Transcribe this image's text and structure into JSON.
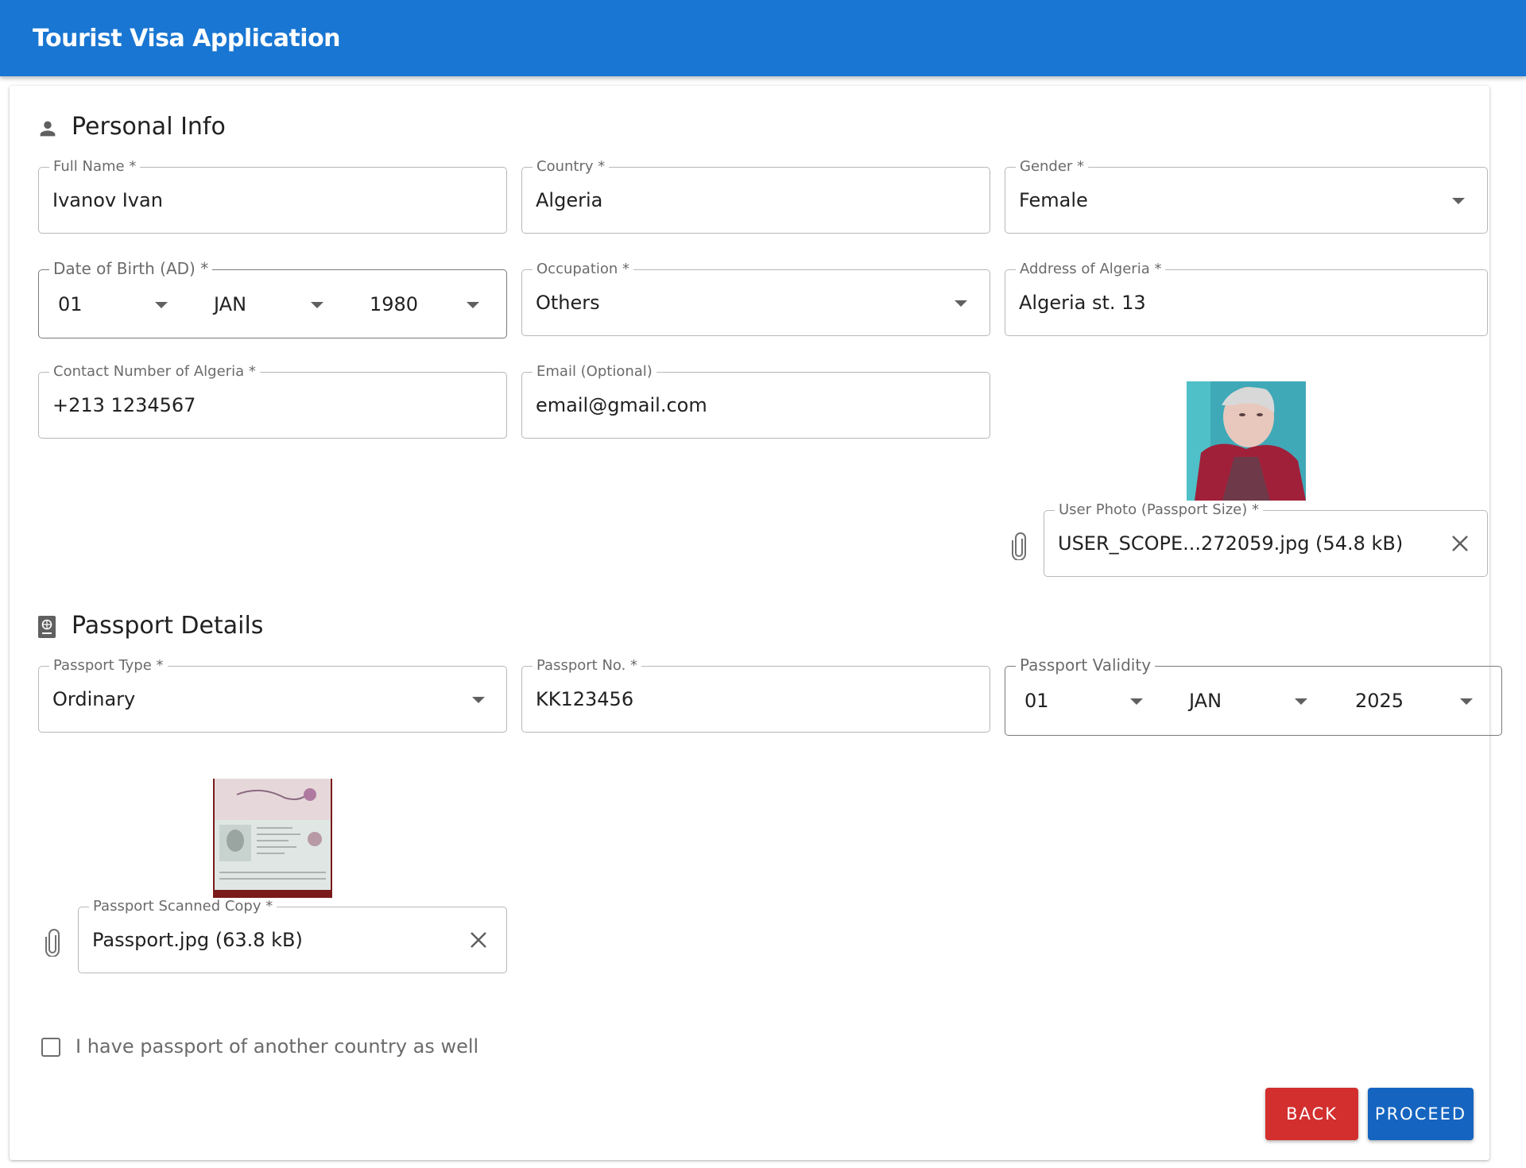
{
  "appbar": {
    "title": "Tourist Visa Application"
  },
  "personal": {
    "section_title": "Personal Info",
    "icon": "person-icon",
    "full_name": {
      "label": "Full Name *",
      "value": "Ivanov Ivan"
    },
    "country": {
      "label": "Country *",
      "value": "Algeria"
    },
    "gender": {
      "label": "Gender *",
      "value": "Female"
    },
    "dob": {
      "label": "Date of Birth (AD) *",
      "day": "01",
      "month": "JAN",
      "year": "1980"
    },
    "occupation": {
      "label": "Occupation *",
      "value": "Others"
    },
    "address": {
      "label": "Address of Algeria *",
      "value": "Algeria st. 13"
    },
    "contact": {
      "label": "Contact Number of Algeria *",
      "value": "+213 1234567"
    },
    "email": {
      "label": "Email (Optional)",
      "value": "email@gmail.com"
    },
    "user_photo": {
      "label": "User Photo (Passport Size) *",
      "value": "USER_SCOPE...272059.jpg (54.8 kB)"
    }
  },
  "passport": {
    "section_title": "Passport Details",
    "icon": "passport-icon",
    "type": {
      "label": "Passport Type *",
      "value": "Ordinary"
    },
    "number": {
      "label": "Passport No. *",
      "value": "KK123456"
    },
    "validity": {
      "label": "Passport Validity",
      "day": "01",
      "month": "JAN",
      "year": "2025"
    },
    "scan": {
      "label": "Passport Scanned Copy *",
      "value": "Passport.jpg (63.8 kB)"
    }
  },
  "other_passport": {
    "label": "I have passport of another country as well",
    "checked": false
  },
  "actions": {
    "back": "BACK",
    "proceed": "PROCEED"
  },
  "colors": {
    "appbar": "#1976d2",
    "back_button": "#d32f2f",
    "proceed_button": "#1565c0"
  }
}
